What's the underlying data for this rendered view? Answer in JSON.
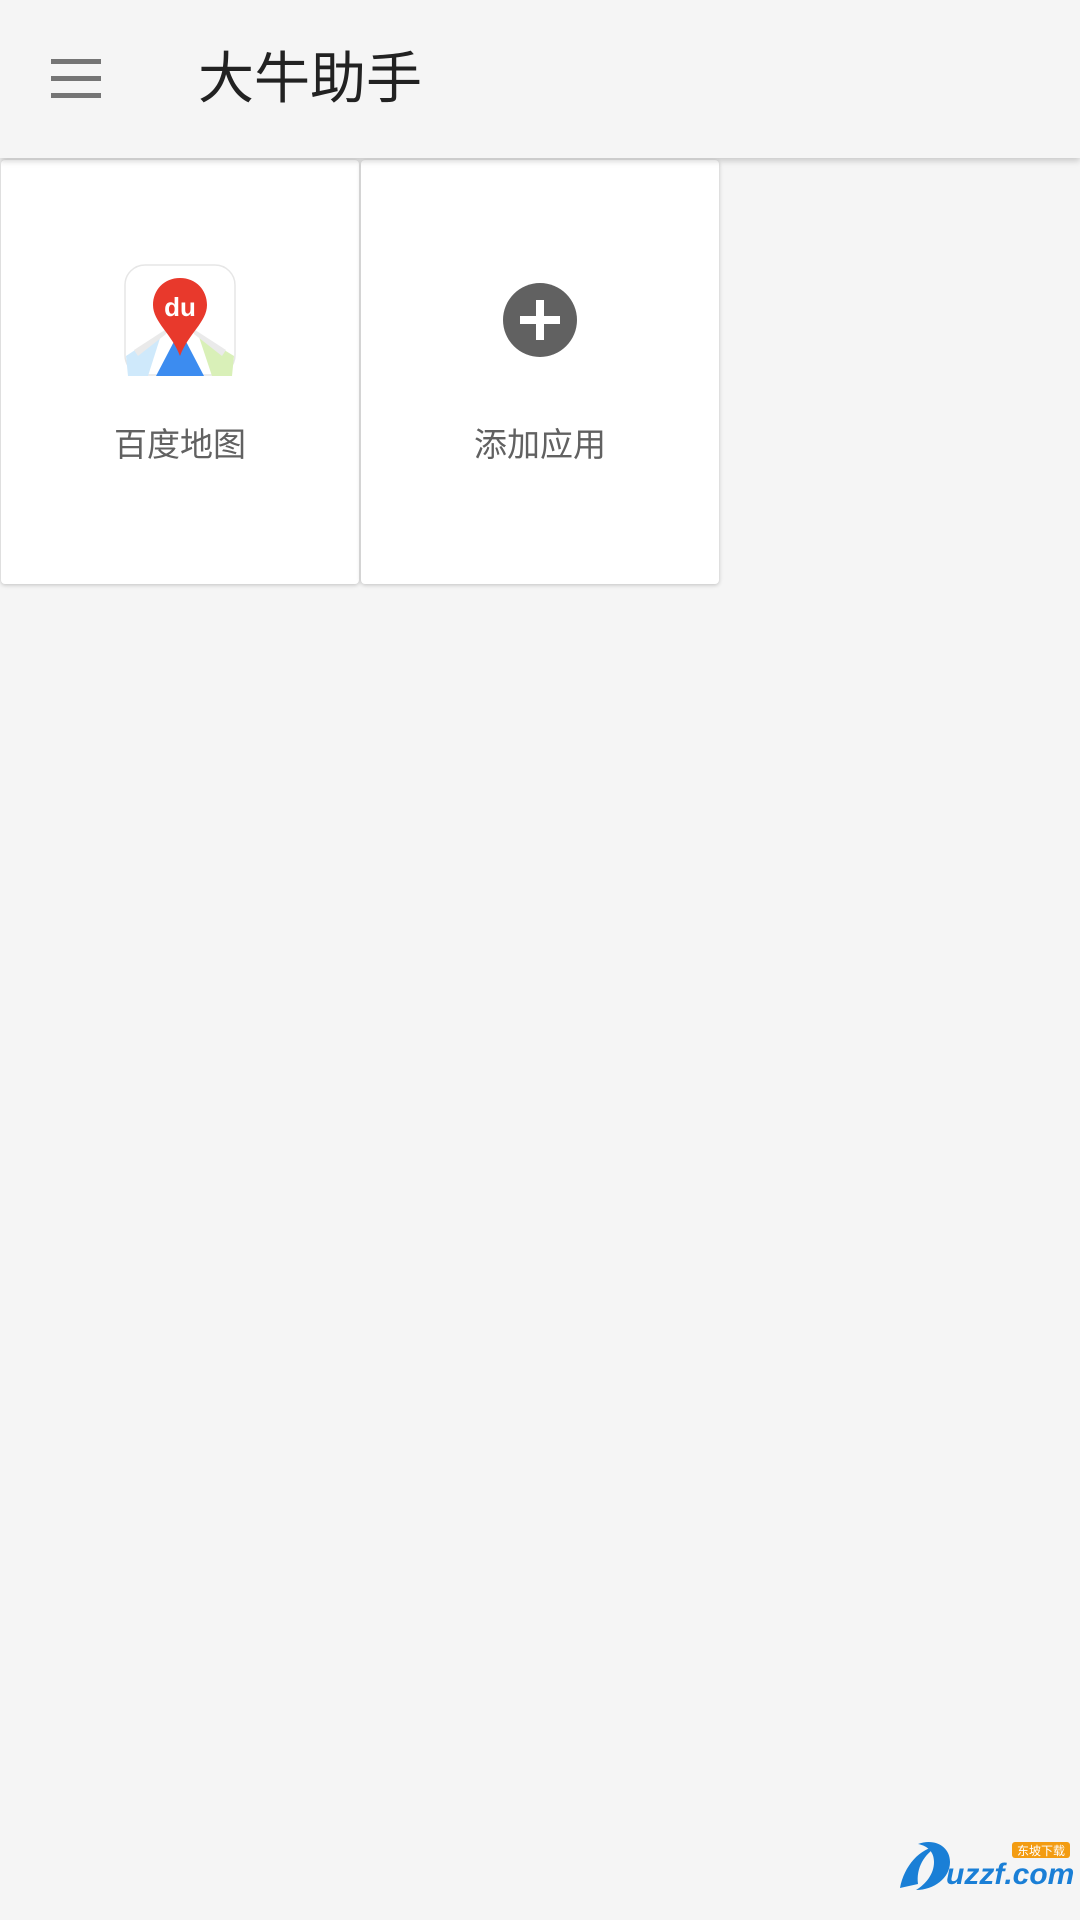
{
  "app_bar": {
    "title": "大牛助手",
    "menu_icon": "hamburger-menu-icon"
  },
  "tiles": [
    {
      "label": "百度地图",
      "icon": "baidu-map-icon",
      "icon_text": "du"
    },
    {
      "label": "添加应用",
      "icon": "add-circle-icon"
    }
  ],
  "watermark": {
    "text": "uzzf.com",
    "sub_text": "东坡下载",
    "icon": "uzzf-logo-icon"
  },
  "colors": {
    "background": "#f5f5f5",
    "tile_background": "#ffffff",
    "title_text": "#222222",
    "label_text": "#616161",
    "menu_icon": "#757575",
    "add_icon": "#616161",
    "baidu_pin_red": "#e8392c",
    "baidu_map_blue": "#3c8cf0"
  }
}
